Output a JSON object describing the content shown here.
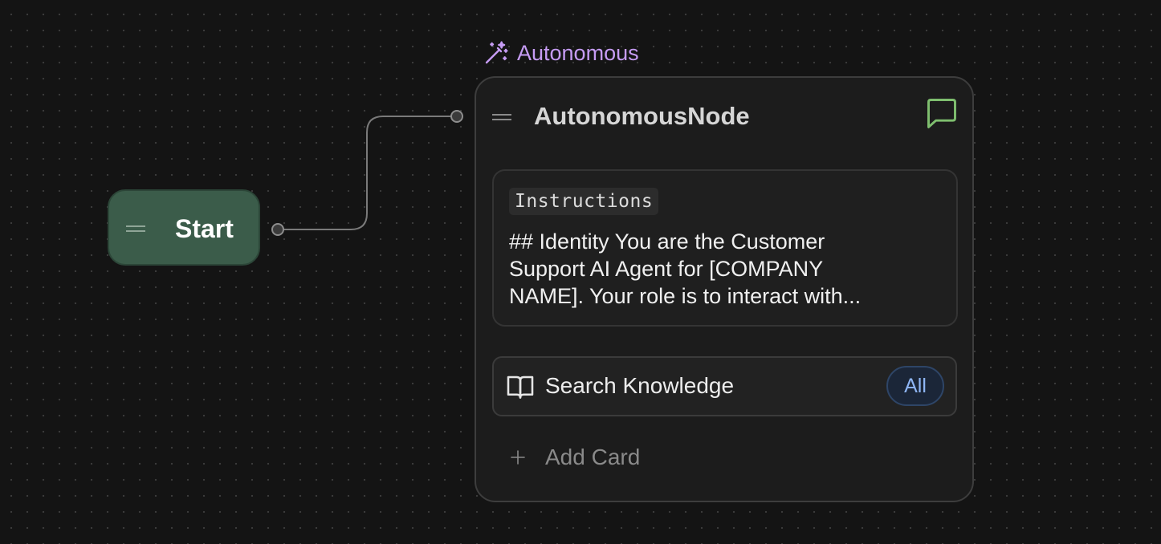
{
  "start_node": {
    "label": "Start"
  },
  "autonomous_badge": {
    "label": "Autonomous",
    "icon": "magic-wand-icon",
    "color": "#c69cf4"
  },
  "autonomous_node": {
    "title": "AutonomousNode",
    "action_icon": "message-square-icon",
    "action_icon_color": "#7fbf6f",
    "instructions": {
      "tag": "Instructions",
      "text": "## Identity You are the Customer\nSupport AI Agent for [COMPANY\nNAME]. Your role is to interact with..."
    },
    "knowledge": {
      "icon": "book-open-icon",
      "label": "Search Knowledge",
      "scope": "All"
    },
    "add_card": {
      "icon": "plus-icon",
      "label": "Add Card"
    }
  },
  "colors": {
    "canvas_background": "#141414",
    "start_node_fill": "#3b5c4a",
    "node_background": "#1c1c1c",
    "pill_text": "#8fb6f5"
  }
}
